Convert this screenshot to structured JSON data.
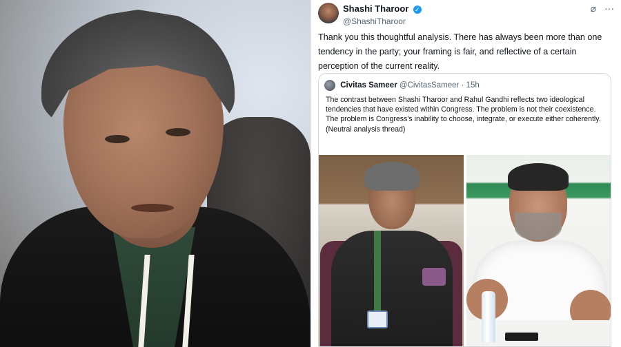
{
  "left_photo": {
    "alt": ""
  },
  "tweet": {
    "author": {
      "display_name": "Shashi Tharoor",
      "handle": "@ShashiTharoor",
      "verified": true,
      "verified_color": "#1d9bf0"
    },
    "header_icons": [
      "grok-icon",
      "more-options-icon"
    ],
    "text": "Thank you this thoughtful analysis. There has always been more than one tendency in the party; your framing is fair, and reflective of a certain perception of the current reality.",
    "quoted": {
      "display_name": "Civitas Sameer",
      "handle": "@CivitasSameer",
      "separator": "·",
      "time": "15h",
      "text": "The contrast between Shashi Tharoor and Rahul Gandhi reflects two ideological tendencies that have existed within Congress. The problem is not their coexistence. The problem is Congress's inability to choose, integrate, or execute either coherently.",
      "note": "(Neutral analysis thread)"
    }
  }
}
